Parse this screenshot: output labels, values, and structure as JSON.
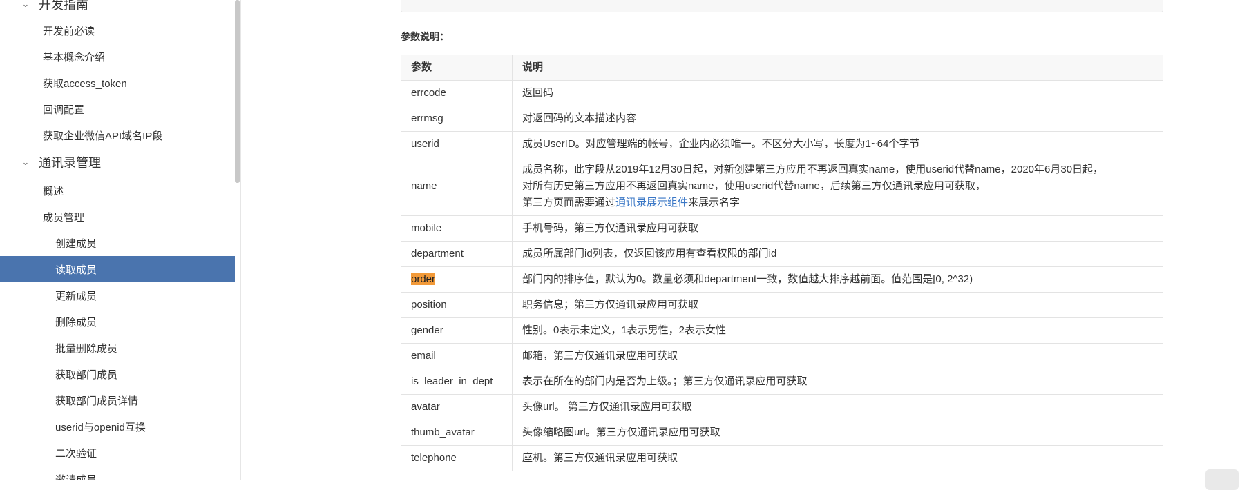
{
  "sidebar": {
    "section_dev": "开发指南",
    "dev_items": [
      "开发前必读",
      "基本概念介绍",
      "获取access_token",
      "回调配置",
      "获取企业微信API域名IP段"
    ],
    "section_contacts": "通讯录管理",
    "contacts_items": [
      "概述",
      "成员管理"
    ],
    "member_items": [
      "创建成员",
      "读取成员",
      "更新成员",
      "删除成员",
      "批量删除成员",
      "获取部门成员",
      "获取部门成员详情",
      "userid与openid互换",
      "二次验证",
      "邀请成员"
    ],
    "active_item": "读取成员"
  },
  "main": {
    "params_title": "参数说明：",
    "table": {
      "headers": [
        "参数",
        "说明"
      ],
      "rows": [
        {
          "param": "errcode",
          "desc": "返回码"
        },
        {
          "param": "errmsg",
          "desc": "对返回码的文本描述内容"
        },
        {
          "param": "userid",
          "desc": "成员UserID。对应管理端的帐号，企业内必须唯一。不区分大小写，长度为1~64个字节"
        },
        {
          "param": "name",
          "desc_line1": "成员名称，此字段从2019年12月30日起，对新创建第三方应用不再返回真实name，使用userid代替name，2020年6月30日起，",
          "desc_line2": "对所有历史第三方应用不再返回真实name，使用userid代替name，后续第三方仅通讯录应用可获取，",
          "desc_line3_pre": "第三方页面需要通过",
          "desc_line3_link": "通讯录展示组件",
          "desc_line3_post": "来展示名字"
        },
        {
          "param": "mobile",
          "desc": "手机号码，第三方仅通讯录应用可获取"
        },
        {
          "param": "department",
          "desc": "成员所属部门id列表，仅返回该应用有查看权限的部门id"
        },
        {
          "param": "order",
          "desc": "部门内的排序值，默认为0。数量必须和department一致，数值越大排序越前面。值范围是[0, 2^32)"
        },
        {
          "param": "position",
          "desc": "职务信息；第三方仅通讯录应用可获取"
        },
        {
          "param": "gender",
          "desc": "性别。0表示未定义，1表示男性，2表示女性"
        },
        {
          "param": "email",
          "desc": "邮箱，第三方仅通讯录应用可获取"
        },
        {
          "param": "is_leader_in_dept",
          "desc": "表示在所在的部门内是否为上级。；第三方仅通讯录应用可获取"
        },
        {
          "param": "avatar",
          "desc": "头像url。 第三方仅通讯录应用可获取"
        },
        {
          "param": "thumb_avatar",
          "desc": "头像缩略图url。第三方仅通讯录应用可获取"
        },
        {
          "param": "telephone",
          "desc": "座机。第三方仅通讯录应用可获取"
        }
      ]
    }
  }
}
